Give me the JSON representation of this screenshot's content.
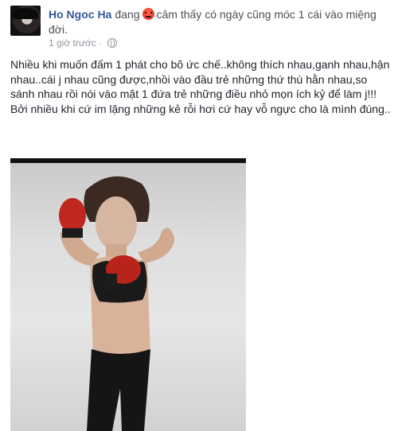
{
  "post": {
    "author": "Ho Ngoc Ha",
    "feeling_prefix": "đang",
    "feeling_icon": "angry-emoji-icon",
    "feeling_text": "cảm thấy có ngày cũng móc 1 cái vào miệng đời.",
    "timestamp": "1 giờ trước",
    "separator": "·",
    "privacy_icon": "globe-icon",
    "paragraphs": [
      "Nhiều khi muốn đấm 1 phát cho bõ ức chế..không thích nhau,ganh nhau,hận nhau..cái j nhau cũng được,nhồi vào đầu trẻ những thứ thù hằn nhau,so sánh nhau rồi nói vào mặt 1 đứa trẻ những điều nhỏ mọn ích kỷ để làm j!!!",
      "Bởi nhiều khi cứ im lặng những kẻ rỗi hơi cứ hay vỗ ngực cho là mình đúng.."
    ]
  },
  "colors": {
    "author": "#365899",
    "meta": "#90949c",
    "text": "#1d2129",
    "glove": "#c0271f"
  }
}
